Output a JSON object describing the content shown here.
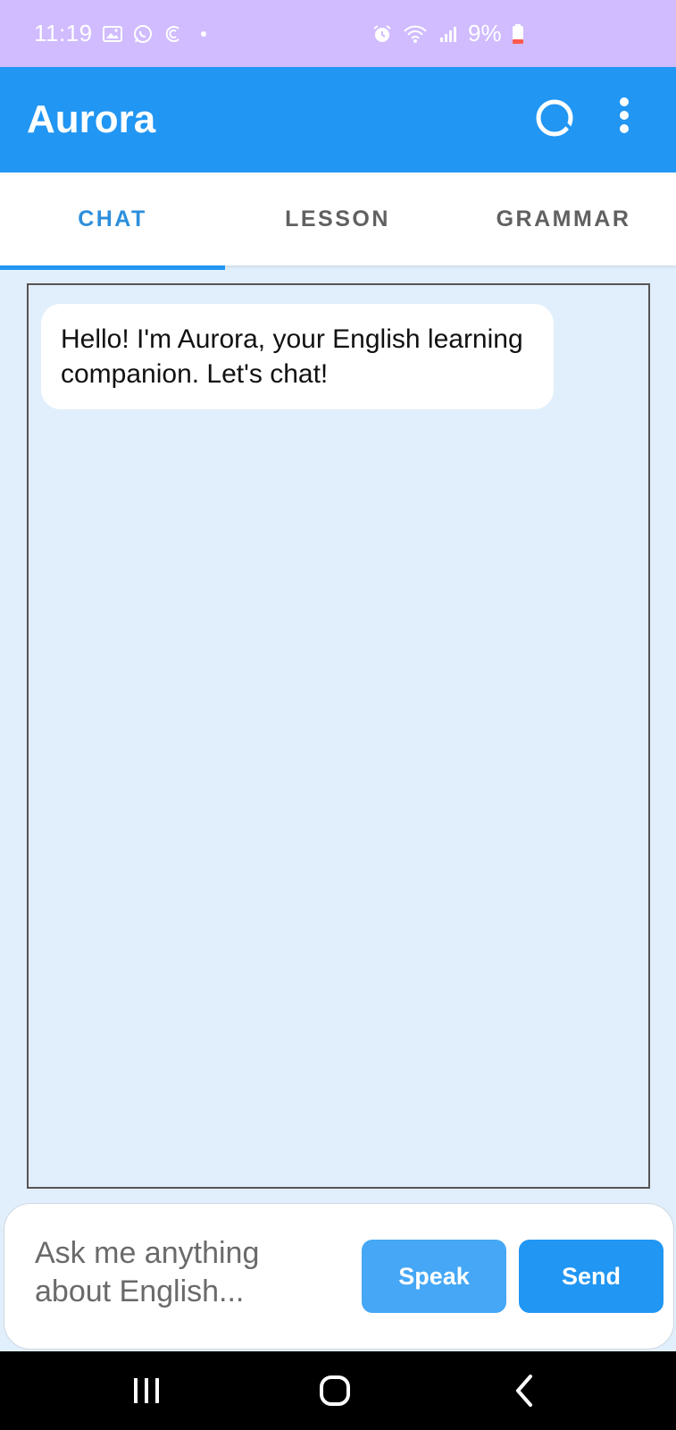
{
  "status_bar": {
    "time": "11:19",
    "battery": "9%",
    "background": "#d0bcff",
    "icons_left": [
      "gallery-icon",
      "whatsapp-icon",
      "app-c-icon",
      "dot-icon"
    ],
    "icons_right": [
      "alarm-icon",
      "wifi-icon",
      "signal-icon",
      "battery-low-icon"
    ]
  },
  "app_bar": {
    "title": "Aurora",
    "background": "#2196f3",
    "actions": [
      "refresh-icon",
      "more-vert-icon"
    ]
  },
  "tabs": [
    {
      "label": "CHAT",
      "active": true
    },
    {
      "label": "LESSON",
      "active": false
    },
    {
      "label": "GRAMMAR",
      "active": false
    }
  ],
  "chat": {
    "messages": [
      {
        "sender": "bot",
        "text": "Hello! I'm Aurora, your English learning companion. Let's chat!"
      }
    ]
  },
  "input": {
    "placeholder": "Ask me anything about English...",
    "value": "",
    "speak_label": "Speak",
    "send_label": "Send"
  },
  "nav_bar": {
    "buttons": [
      "recents-icon",
      "home-icon",
      "back-icon"
    ]
  }
}
